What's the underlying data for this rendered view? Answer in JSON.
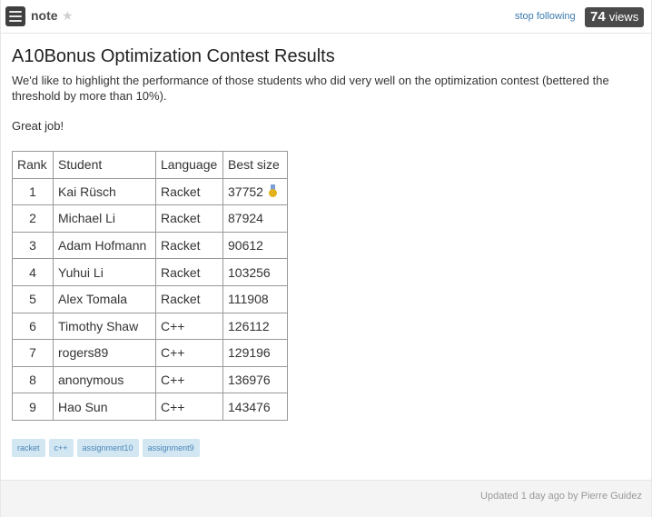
{
  "header": {
    "note_label": "note",
    "star_icon": "star-icon",
    "stop_following": "stop following",
    "views_count": "74",
    "views_text": "views"
  },
  "post": {
    "title": "A10Bonus Optimization Contest Results",
    "intro": "We'd like to highlight the performance of those students who did very well on the optimization contest (bettered the threshold by more than 10%).",
    "greeting": "Great job!"
  },
  "table": {
    "headers": [
      "Rank",
      "Student",
      "Language",
      "Best size"
    ],
    "rows": [
      [
        "1",
        "Kai Rüsch",
        "Racket",
        "37752"
      ],
      [
        "2",
        "Michael Li",
        "Racket",
        "87924"
      ],
      [
        "3",
        "Adam Hofmann",
        "Racket",
        "90612"
      ],
      [
        "4",
        "Yuhui Li",
        "Racket",
        "103256"
      ],
      [
        "5",
        "Alex Tomala",
        "Racket",
        "111908"
      ],
      [
        "6",
        "Timothy Shaw",
        "C++",
        "126112"
      ],
      [
        "7",
        "rogers89",
        "C++",
        "129196"
      ],
      [
        "8",
        "anonymous",
        "C++",
        "136976"
      ],
      [
        "9",
        "Hao Sun",
        "C++",
        "143476"
      ]
    ],
    "first_place_icon": "medal-icon"
  },
  "tags": [
    "racket",
    "c++",
    "assignment10",
    "assignment9"
  ],
  "footer": {
    "updated": "Updated 1 day ago by Pierre Guidez"
  },
  "colors": {
    "link": "#3c7ab0",
    "badge_bg": "#4a4a4a",
    "tag_bg": "#d3e7f3",
    "tag_text": "#4a86b8",
    "medal": "#e3b21a"
  }
}
